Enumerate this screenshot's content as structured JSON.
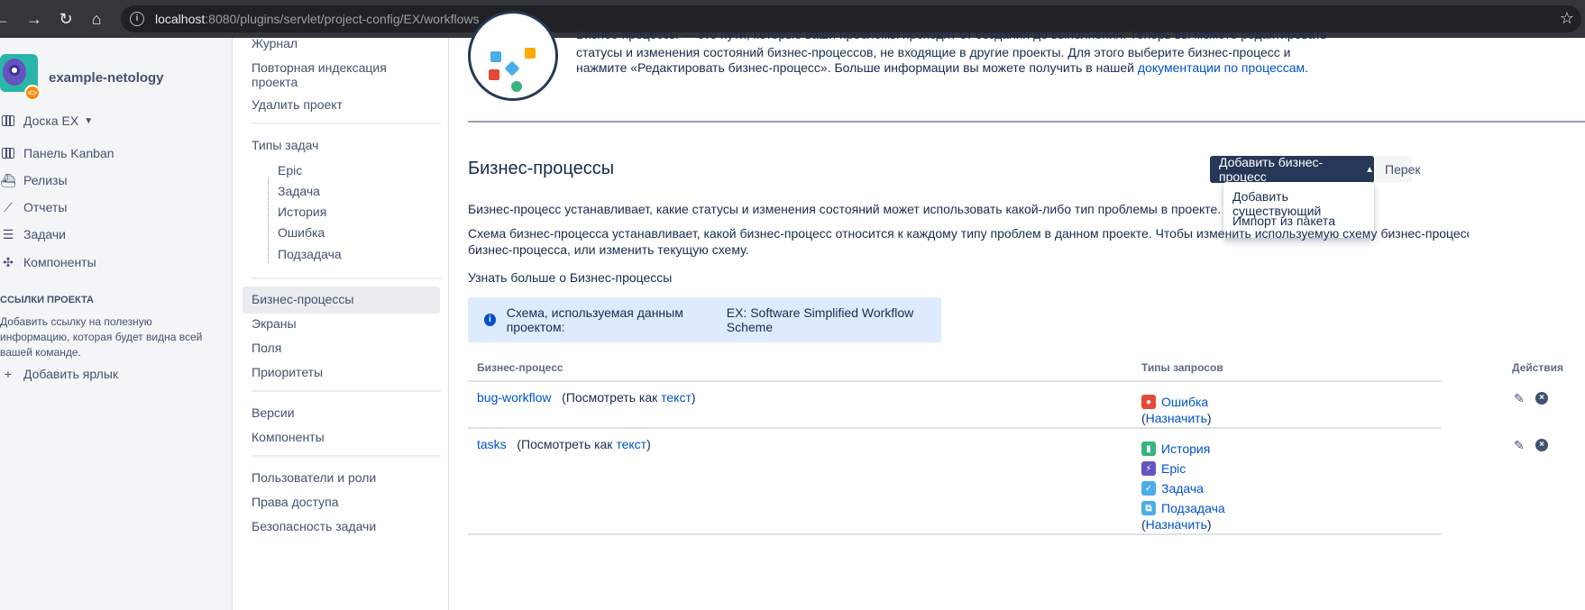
{
  "browser": {
    "url_host": "localhost",
    "url_rest": ":8080/plugins/servlet/project-config/EX/workflows"
  },
  "sidebar": {
    "project_name": "example-netology",
    "board": "Доска EX",
    "items": [
      "Панель Kanban",
      "Релизы",
      "Отчеты",
      "Задачи",
      "Компоненты"
    ],
    "links_heading": "ССЫЛКИ ПРОЕКТА",
    "links_note": "Добавить ссылку на полезную информацию, которая будет видна всей вашей команде.",
    "add_shortcut": "Добавить ярлык"
  },
  "settings_nav": {
    "log": "Журнал",
    "reindex": "Повторная индексация проекта",
    "delete": "Удалить проект",
    "issue_types": "Типы задач",
    "types": [
      "Epic",
      "Задача",
      "История",
      "Ошибка",
      "Подзадача"
    ],
    "workflows": "Бизнес-процессы",
    "screens": "Экраны",
    "fields": "Поля",
    "priorities": "Приоритеты",
    "versions": "Версии",
    "components": "Компоненты",
    "users_roles": "Пользователи и роли",
    "permissions": "Права доступа",
    "security": "Безопасность задачи"
  },
  "main": {
    "intro_line1": "Бизнес-процессы — это пути, которые ваши проблемы проходят от создания до выполнения. Теперь вы можете редактировать",
    "intro_line2": "статусы и изменения состояний бизнес-процессов, не входящие в другие проекты. Для этого выберите бизнес-процесс и",
    "intro_line3": "нажмите «Редактировать бизнес-процесс». Больше информации вы можете получить в нашей",
    "intro_link": "документации по процессам",
    "heading": "Бизнес-процессы",
    "add_button": "Добавить бизнес-процесс",
    "next_button": "Перек",
    "dropdown": [
      "Добавить существующий",
      "Импорт из пакета"
    ],
    "para1": "Бизнес-процесс устанавливает, какие статусы и изменения состояний может использовать какой-либо тип проблемы в проекте.",
    "para2_line1": "Схема бизнес-процесса устанавливает, какой бизнес-процесс относится к каждому типу проблем в данном проекте. Чтобы изменить используемую схему бизнес-процесса, можно выбрать",
    "para2_line2": "бизнес-процесса, или изменить текущую схему.",
    "learn_more": "Узнать больше о Бизнес-процессы",
    "scheme_label": "Схема, используемая данным проектом:",
    "scheme_name": "EX: Software Simplified Workflow Scheme",
    "table_headers": [
      "Бизнес-процесс",
      "Типы запросов",
      "Действия"
    ],
    "view_as_prefix": "(Посмотреть как",
    "view_as_link": "текст",
    "view_as_suffix": ")",
    "assign_prefix": "(",
    "assign_link": "Назначить",
    "assign_suffix": ")",
    "rows": [
      {
        "name": "bug-workflow",
        "types": [
          "Ошибка"
        ]
      },
      {
        "name": "tasks",
        "types": [
          "История",
          "Epic",
          "Задача",
          "Подзадача"
        ]
      }
    ]
  },
  "colors": {
    "primary_button": "#253858",
    "link": "#0052cc",
    "info_bg": "#deebff",
    "bug": "#e5493a",
    "story": "#36b37e",
    "epic": "#6554c0",
    "task": "#4bade8",
    "subtask": "#4bade8"
  }
}
